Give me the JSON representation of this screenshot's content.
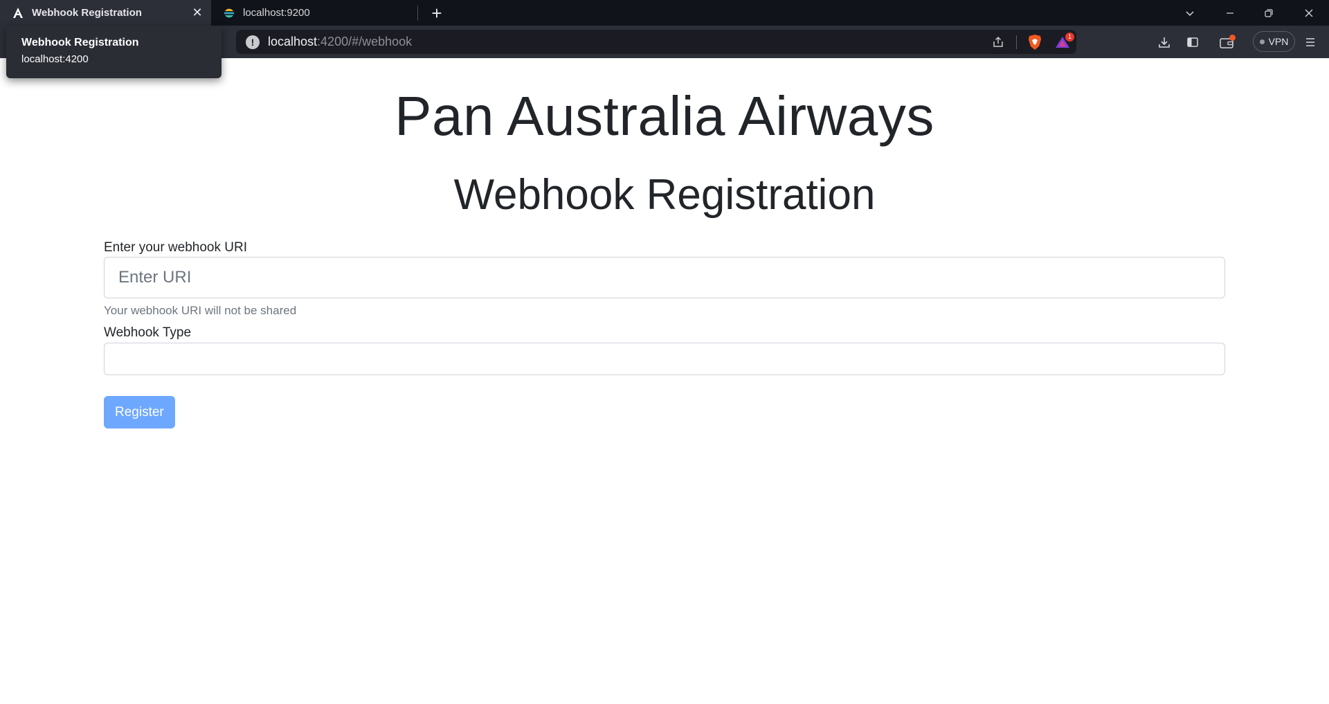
{
  "browser": {
    "tabs": [
      {
        "title": "Webhook Registration",
        "active": true,
        "favicon": "angular-icon"
      },
      {
        "title": "localhost:9200",
        "active": false,
        "favicon": "elastic-icon"
      }
    ],
    "tooltip": {
      "title": "Webhook Registration",
      "url": "localhost:4200"
    },
    "address": {
      "host": "localhost",
      "path": ":4200/#/webhook"
    },
    "vpn_label": "VPN",
    "rewards_badge": "1"
  },
  "page": {
    "brand_title": "Pan Australia Airways",
    "heading": "Webhook Registration",
    "uri_label": "Enter your webhook URI",
    "uri_placeholder": "Enter URI",
    "uri_value": "",
    "uri_help": "Your webhook URI will not be shared",
    "type_label": "Webhook Type",
    "type_value": "",
    "register_label": "Register",
    "colors": {
      "primary_disabled": "#6ea8fe",
      "text": "#212529",
      "muted": "#6c757d",
      "border": "#ced4da"
    }
  }
}
